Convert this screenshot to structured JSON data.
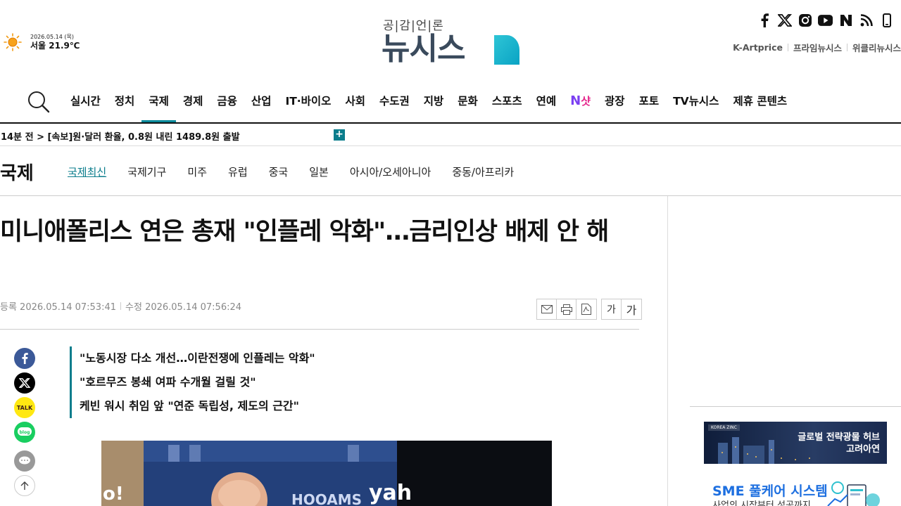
{
  "weather": {
    "date": "2026.05.14 (목)",
    "temp": "서울 21.9℃",
    "icon": "sun-icon"
  },
  "logo": {
    "slogan": "공|감|언|론",
    "name": "뉴시스"
  },
  "social_icons": [
    "facebook-icon",
    "x-icon",
    "instagram-icon",
    "youtube-icon",
    "naver-icon",
    "rss-icon",
    "mobile-icon"
  ],
  "partners": [
    "K-Artprice",
    "프라임뉴시스",
    "위클리뉴시스"
  ],
  "gnb": {
    "items": [
      "실시간",
      "정치",
      "국제",
      "경제",
      "금융",
      "산업",
      "IT·바이오",
      "사회",
      "수도권",
      "지방",
      "문화",
      "스포츠",
      "연예",
      "N샷",
      "광장",
      "포토",
      "TV뉴시스",
      "제휴 콘텐츠"
    ],
    "active": "국제"
  },
  "breaking": {
    "text": "14분 전 > [속보]원·달러 환율, 0.8원 내린 1489.8원 출발",
    "plus": "+"
  },
  "section": {
    "title": "국제",
    "tabs": [
      "국제최신",
      "국제기구",
      "미주",
      "유럽",
      "중국",
      "일본",
      "아시아/오세아니아",
      "중동/아프리카"
    ],
    "active": "국제최신"
  },
  "article": {
    "headline": "미니애폴리스 연은 총재 \"인플레 악화\"…금리인상 배제 안 해",
    "registered": "등록 2026.05.14 07:53:41",
    "modified": "수정 2026.05.14 07:56:24",
    "summary": [
      "\"노동시장 다소 개선…이란전쟁에 인플레는 악화\"",
      "\"호르무즈 봉쇄 여파 수개월 걸릴 것\"",
      "케빈 워시 취임 앞 \"연준 독립성, 제도의 근간\""
    ],
    "font_small": "가",
    "font_large": "가"
  },
  "photo_text": {
    "left": "o!",
    "middle": "HOOAMS",
    "right": "yah"
  },
  "ads": {
    "ad1": {
      "brand": "KOREA ZINC",
      "line1": "글로벌 전략광물 허브",
      "line2": "고려아연"
    },
    "ad2": {
      "title": "SME 풀케어 시스템",
      "subtitle": "사업의 시작부터 성공까지"
    }
  },
  "colors": {
    "accent": "#0b7d8c",
    "text": "#111111",
    "meta": "#888888"
  }
}
